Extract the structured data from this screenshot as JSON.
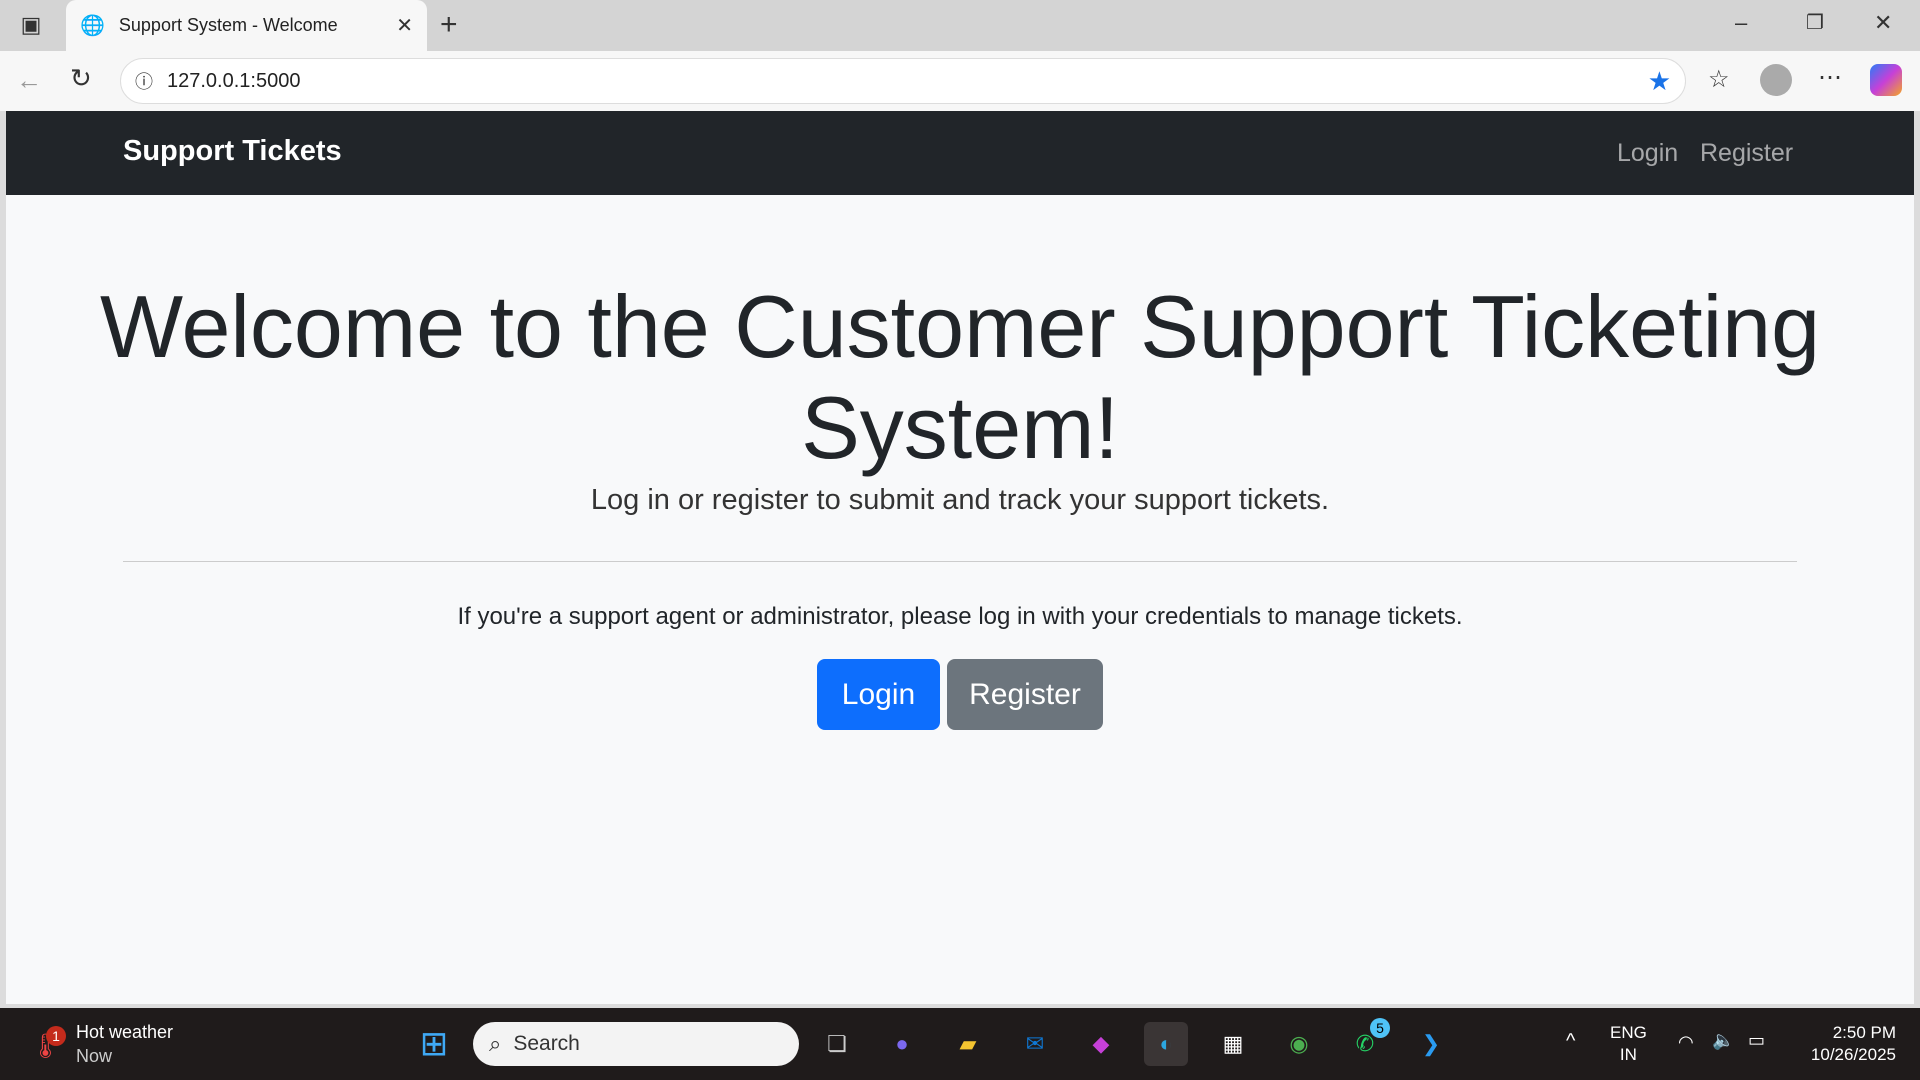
{
  "browser": {
    "tab_title": "Support System - Welcome",
    "url": "127.0.0.1:5000"
  },
  "navbar": {
    "brand": "Support Tickets",
    "links": [
      "Login",
      "Register"
    ]
  },
  "main": {
    "heading": "Welcome to the Customer Support Ticketing System!",
    "lead": "Log in or register to submit and track your support tickets.",
    "info": "If you're a support agent or administrator, please log in with your credentials to manage tickets.",
    "login_button": "Login",
    "register_button": "Register"
  },
  "colors": {
    "primary": "#0d6efd",
    "secondary": "#6c757d",
    "navbar": "#212529"
  },
  "taskbar": {
    "weather_title": "Hot weather",
    "weather_sub": "Now",
    "weather_badge": "1",
    "search": "Search",
    "whatsapp_badge": "5",
    "lang": "ENG",
    "region": "IN",
    "time": "2:50 PM",
    "date": "10/26/2025"
  }
}
